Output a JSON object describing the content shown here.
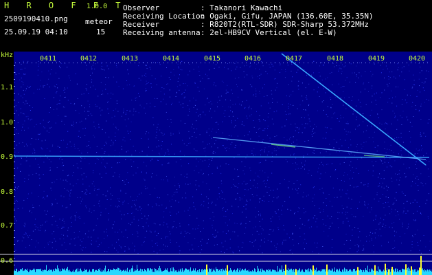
{
  "app": {
    "name": "H R O F F T",
    "version": "1.0.0"
  },
  "file": {
    "name": "2509190410.png",
    "datetime": "25.09.19 04:10"
  },
  "meteor": {
    "label": "meteor",
    "count": "15"
  },
  "info": [
    {
      "key": "Observer",
      "value": ": Takanori Kawachi"
    },
    {
      "key": "Receiving Location",
      "value": ": Ogaki, Gifu, JAPAN (136.60E, 35.35N)"
    },
    {
      "key": "Receiver",
      "value": ": R820T2(RTL-SDR) SDR-Sharp 53.372MHz"
    },
    {
      "key": "Receiving antenna",
      "value": ": 2el-HB9CV Vertical (el. E-W)"
    }
  ],
  "axis": {
    "unit": "kHz",
    "y_ticks": [
      "1.1",
      "1.0",
      "0.9",
      "0.8",
      "0.7",
      "0.6"
    ],
    "time_ticks": [
      "0411",
      "0412",
      "0413",
      "0414",
      "0415",
      "0416",
      "0417",
      "0418",
      "0419",
      "0420"
    ]
  },
  "colors": {
    "text_green": "#c8ff3c",
    "bg_blue": "#00008a",
    "carrier": "#39a8ff",
    "noise_cyan": "#28d8ff"
  }
}
